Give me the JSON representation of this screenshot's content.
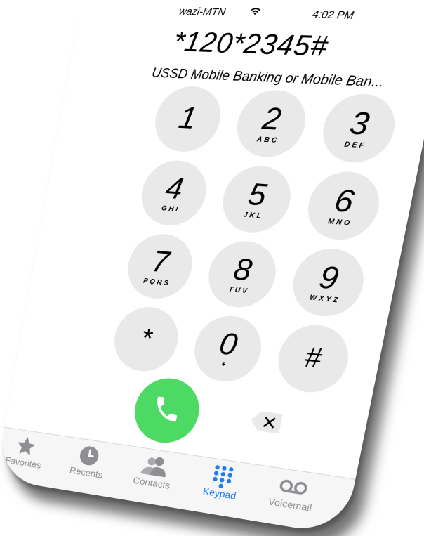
{
  "status": {
    "carrier": "wazi-MTN",
    "time": "4:02 PM"
  },
  "dialer": {
    "number": "*120*2345#",
    "contact_label": "USSD Mobile Banking or Mobile Ban...",
    "keys": [
      {
        "digit": "1",
        "letters": ""
      },
      {
        "digit": "2",
        "letters": "ABC"
      },
      {
        "digit": "3",
        "letters": "DEF"
      },
      {
        "digit": "4",
        "letters": "GHI"
      },
      {
        "digit": "5",
        "letters": "JKL"
      },
      {
        "digit": "6",
        "letters": "MNO"
      },
      {
        "digit": "7",
        "letters": "PQRS"
      },
      {
        "digit": "8",
        "letters": "TUV"
      },
      {
        "digit": "9",
        "letters": "WXYZ"
      },
      {
        "digit": "*",
        "letters": ""
      },
      {
        "digit": "0",
        "letters": "+"
      },
      {
        "digit": "#",
        "letters": ""
      }
    ]
  },
  "tabs": [
    {
      "label": "Favorites",
      "icon": "star-icon"
    },
    {
      "label": "Recents",
      "icon": "clock-icon"
    },
    {
      "label": "Contacts",
      "icon": "contacts-icon"
    },
    {
      "label": "Keypad",
      "icon": "keypad-icon",
      "active": true
    },
    {
      "label": "Voicemail",
      "icon": "voicemail-icon"
    }
  ],
  "colors": {
    "call": "#4cd964",
    "active_tab": "#1e7cf2",
    "key_bg": "#e9e9ea"
  }
}
